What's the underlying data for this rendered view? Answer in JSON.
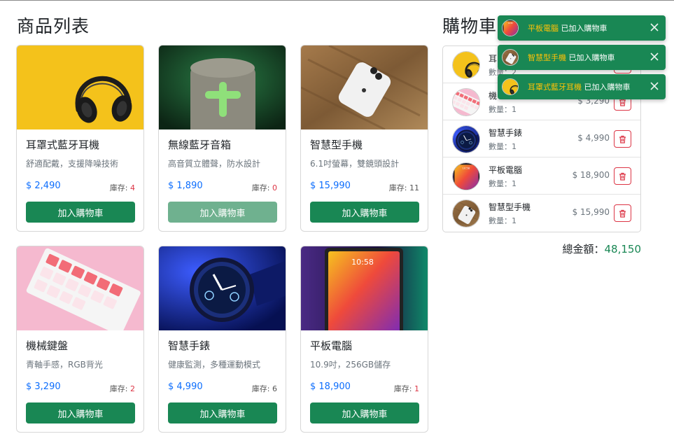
{
  "products_title": "商品列表",
  "cart_title": "購物車",
  "add_label": "加入購物車",
  "stock_prefix": "庫存: ",
  "products": [
    {
      "name": "耳罩式藍牙耳機",
      "desc": "舒適配戴，支援降噪技術",
      "price": "$ 2,490",
      "stock": "4",
      "image": "headphones-image"
    },
    {
      "name": "無線藍牙音箱",
      "desc": "高音質立體聲，防水設計",
      "price": "$ 1,890",
      "stock": "0",
      "image": "speaker-image"
    },
    {
      "name": "智慧型手機",
      "desc": "6.1吋螢幕，雙鏡頭設計",
      "price": "$ 15,990",
      "stock": "11",
      "image": "phone-image"
    },
    {
      "name": "機械鍵盤",
      "desc": "青軸手感，RGB背光",
      "price": "$ 3,290",
      "stock": "2",
      "image": "keyboard-image"
    },
    {
      "name": "智慧手錶",
      "desc": "健康監測，多種運動模式",
      "price": "$ 4,990",
      "stock": "6",
      "image": "watch-image"
    },
    {
      "name": "平板電腦",
      "desc": "10.9吋，256GB儲存",
      "price": "$ 18,900",
      "stock": "1",
      "image": "tablet-image"
    }
  ],
  "cart": {
    "qty_prefix": "數量：",
    "items": [
      {
        "name": "耳",
        "qty": "2",
        "price": "",
        "image": "headphones-thumb"
      },
      {
        "name": "機",
        "qty": "1",
        "price": "$ 3,290",
        "image": "keyboard-thumb"
      },
      {
        "name": "智慧手錶",
        "qty": "1",
        "price": "$ 4,990",
        "image": "watch-thumb"
      },
      {
        "name": "平板電腦",
        "qty": "1",
        "price": "$ 18,900",
        "image": "tablet-thumb"
      },
      {
        "name": "智慧型手機",
        "qty": "1",
        "price": "$ 15,990",
        "image": "phone-thumb"
      }
    ],
    "total_label": "總金額：",
    "total_value": "48,150"
  },
  "toasts": [
    {
      "product": "平板電腦",
      "message": " 已加入購物車",
      "icon": "tablet-thumb"
    },
    {
      "product": "智慧型手機",
      "message": " 已加入購物車",
      "icon": "phone-thumb"
    },
    {
      "product": "耳罩式藍牙耳機",
      "message": " 已加入購物車",
      "icon": "headphones-thumb"
    }
  ],
  "colors": {
    "primary_green": "#198754",
    "price_blue": "#0d6efd",
    "danger_red": "#dc3545",
    "highlight_yellow": "#ffc107"
  }
}
